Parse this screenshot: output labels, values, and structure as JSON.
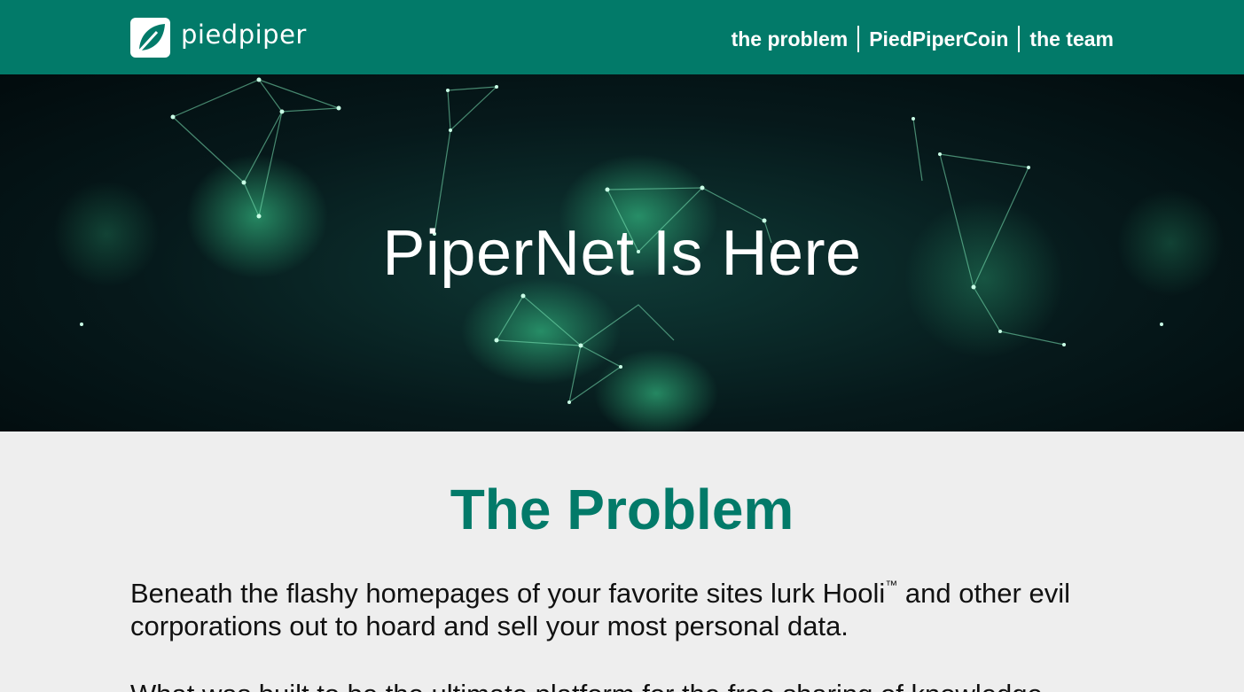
{
  "header": {
    "logo_text": "piedpiper",
    "nav": [
      {
        "label": "the problem"
      },
      {
        "label": "PiedPiperCoin"
      },
      {
        "label": "the team"
      }
    ]
  },
  "hero": {
    "title": "PiperNet Is Here"
  },
  "problem": {
    "title": "The Problem",
    "p1_before": "Beneath the flashy homepages of your favorite sites lurk Hooli",
    "p1_tm": "™",
    "p1_after": " and other evil corporations out to hoard and sell your most personal data.",
    "p2": "What was built to be the ultimate platform for the free sharing of knowledge"
  },
  "colors": {
    "brand": "#027a69",
    "background": "#eeeeee",
    "hero_dark": "#06191b"
  }
}
